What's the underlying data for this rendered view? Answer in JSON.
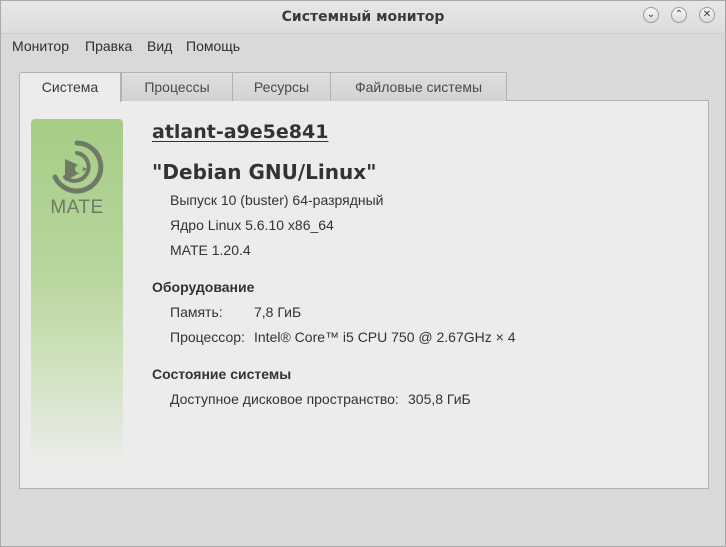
{
  "window": {
    "title": "Системный монитор",
    "controls": {
      "minimize": "⌄",
      "maximize": "⌃",
      "close": "✕"
    }
  },
  "menubar": {
    "items": [
      "Монитор",
      "Правка",
      "Вид",
      "Помощь"
    ]
  },
  "tabs": [
    {
      "label": "Система",
      "active": true
    },
    {
      "label": "Процессы",
      "active": false
    },
    {
      "label": "Ресурсы",
      "active": false
    },
    {
      "label": "Файловые системы",
      "active": false
    }
  ],
  "system": {
    "logo_text": "MATE",
    "hostname": "atlant-a9e5e841",
    "distro": "\"Debian GNU/Linux\"",
    "release": "Выпуск 10 (buster) 64-разрядный",
    "kernel": "Ядро Linux 5.6.10 x86_64",
    "desktop": "MATE 1.20.4",
    "hardware": {
      "heading": "Оборудование",
      "memory_label": "Память:",
      "memory_value": "7,8 ГиБ",
      "cpu_label": "Процессор:",
      "cpu_value": "Intel® Core™ i5 CPU 750 @ 2.67GHz × 4"
    },
    "status": {
      "heading": "Состояние системы",
      "disk_label": "Доступное дисковое пространство:",
      "disk_value": "305,8 ГиБ"
    }
  },
  "colors": {
    "banner_top": "#a6cc86",
    "banner_bottom": "#ececec",
    "window_bg": "#d9d9d9",
    "panel_bg": "#ececec"
  }
}
